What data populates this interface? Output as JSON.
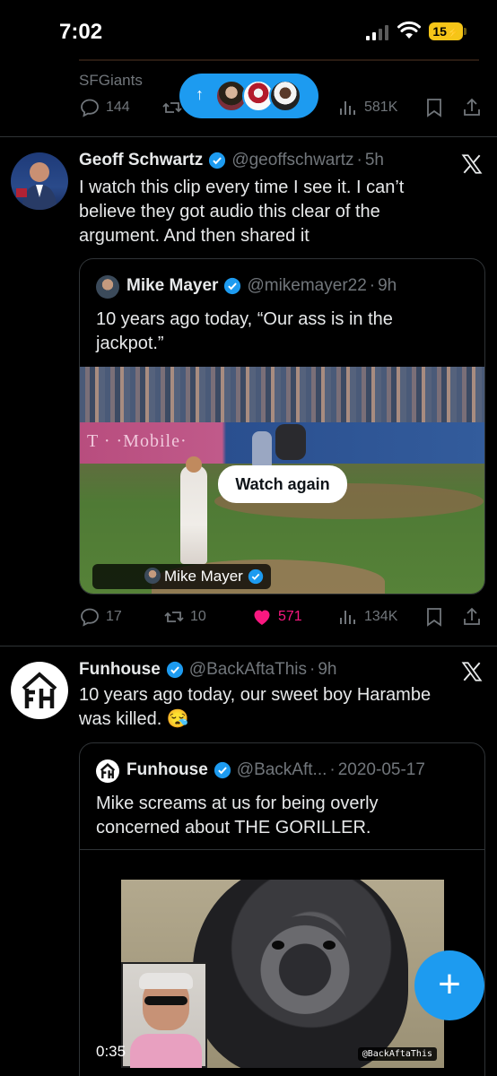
{
  "status": {
    "time": "7:02",
    "battery": "15"
  },
  "prev_tweet": {
    "username": "SFGiants",
    "replies": "144",
    "views": "581K"
  },
  "tweets": [
    {
      "name": "Geoff Schwartz",
      "handle": "@geoffschwartz",
      "time": "5h",
      "text": [
        "I watch this clip every time I see it. I can’t",
        "believe they got audio this clear of the",
        "argument. And then shared it"
      ],
      "quote": {
        "name": "Mike Mayer",
        "handle": "@mikemayer22",
        "time": "9h",
        "text": [
          "10 years ago today, “Our ass is in the",
          "jackpot.”"
        ],
        "media": {
          "button": "Watch again",
          "credit": "Mike Mayer",
          "ad": "T · ·Mobile·"
        }
      },
      "stats": {
        "replies": "17",
        "reposts": "10",
        "likes": "571",
        "views": "134K"
      }
    },
    {
      "name": "Funhouse",
      "handle": "@BackAftaThis",
      "time": "9h",
      "text": [
        "10 years ago today, our sweet boy Harambe",
        "was killed. 😪"
      ],
      "quote": {
        "name": "Funhouse",
        "handle": "@BackAft...",
        "time": "2020-05-17",
        "text": [
          "Mike screams at us for being overly",
          "concerned about THE GORILLER."
        ],
        "media": {
          "duration": "0:35",
          "watermark": "@BackAftaThis"
        }
      }
    }
  ],
  "separator": "·",
  "fab": "+",
  "colors": {
    "accent": "#1d9bf0",
    "like": "#f91880",
    "muted": "#71767b"
  }
}
